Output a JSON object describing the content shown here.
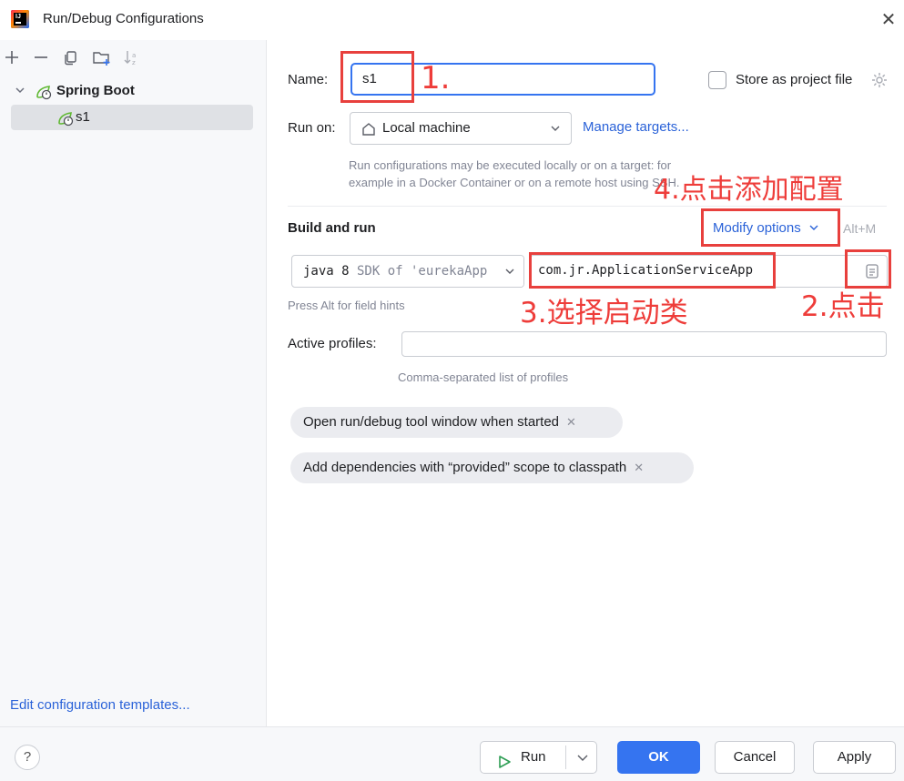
{
  "window": {
    "title": "Run/Debug Configurations",
    "close_symbol": "✕"
  },
  "toolbar": {
    "icons": [
      "add-icon",
      "remove-icon",
      "copy-icon",
      "folder-add-icon",
      "sort-icon"
    ]
  },
  "tree": {
    "group_label": "Spring Boot",
    "items": [
      {
        "label": "s1"
      }
    ]
  },
  "sidebar": {
    "edit_templates_link": "Edit configuration templates..."
  },
  "form": {
    "name_label": "Name:",
    "name_value": "s1",
    "store_label": "Store as project file",
    "run_on_label": "Run on:",
    "run_on_value": "Local machine",
    "manage_targets": "Manage targets...",
    "run_on_hint_line1": "Run configurations may be executed locally or on a target: for",
    "run_on_hint_line2": "example in a Docker Container or on a remote host using SSH.",
    "build_and_run": "Build and run",
    "modify_options": "Modify options",
    "modify_shortcut": "Alt+M",
    "jdk_value_bold": "java 8",
    "jdk_value_rest": " SDK of 'eurekaApp",
    "main_class": "com.jr.ApplicationServiceApp",
    "field_hint": "Press Alt for field hints",
    "active_profiles_label": "Active profiles:",
    "active_profiles_value": "",
    "profiles_hint": "Comma-separated list of profiles",
    "chips": [
      "Open run/debug tool window when started",
      "Add dependencies with “provided” scope to classpath"
    ]
  },
  "annotations": {
    "step1": "1.",
    "step2": "2.点击",
    "step3": "3.选择启动类",
    "step4": "4.点击添加配置",
    "color": "#e8403d"
  },
  "footer": {
    "help": "?",
    "run": "Run",
    "ok": "OK",
    "cancel": "Cancel",
    "apply": "Apply"
  },
  "colors": {
    "accent": "#3574f0",
    "link": "#2a62d8",
    "annotation": "#e8403d"
  }
}
